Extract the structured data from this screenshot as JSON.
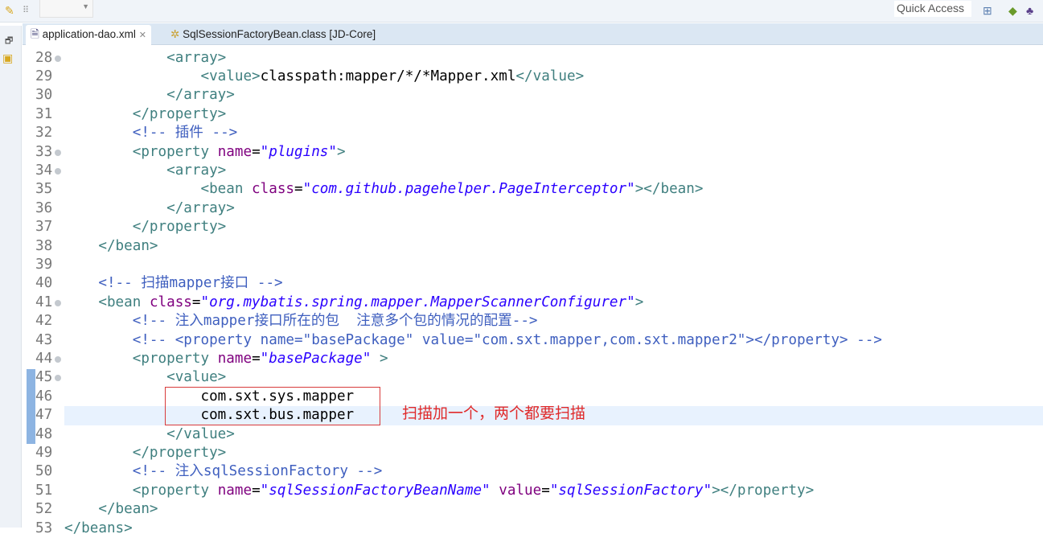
{
  "toolbar": {
    "quick_access_label": "Quick Access"
  },
  "tabs": [
    {
      "label": "application-dao.xml",
      "active": true
    },
    {
      "label": "SqlSessionFactoryBean.class [JD-Core]",
      "active": false
    }
  ],
  "colors": {
    "tag": "#3f7f7f",
    "attr": "#7f007f",
    "value": "#2a00ff",
    "comment": "#3f5fbf",
    "annotation": "#e02a2a"
  },
  "editor": {
    "current_line": 47,
    "changed_lines": [
      45,
      46,
      47,
      48
    ],
    "lines": [
      {
        "n": "28",
        "fold": true,
        "tk": [
          [
            "x",
            "            "
          ],
          [
            "t",
            "<array>"
          ]
        ]
      },
      {
        "n": "29",
        "tk": [
          [
            "x",
            "                "
          ],
          [
            "t",
            "<value>"
          ],
          [
            "x",
            "classpath:mapper/*/*Mapper.xml"
          ],
          [
            "t",
            "</value>"
          ]
        ]
      },
      {
        "n": "30",
        "tk": [
          [
            "x",
            "            "
          ],
          [
            "t",
            "</array>"
          ]
        ]
      },
      {
        "n": "31",
        "tk": [
          [
            "x",
            "        "
          ],
          [
            "t",
            "</property>"
          ]
        ]
      },
      {
        "n": "32",
        "tk": [
          [
            "x",
            "        "
          ],
          [
            "c",
            "<!-- 插件 -->"
          ]
        ]
      },
      {
        "n": "33",
        "fold": true,
        "tk": [
          [
            "x",
            "        "
          ],
          [
            "t",
            "<property "
          ],
          [
            "a",
            "name"
          ],
          [
            "x",
            "="
          ],
          [
            "v",
            "\"plugins\""
          ],
          [
            "t",
            ">"
          ]
        ]
      },
      {
        "n": "34",
        "fold": true,
        "tk": [
          [
            "x",
            "            "
          ],
          [
            "t",
            "<array>"
          ]
        ]
      },
      {
        "n": "35",
        "tk": [
          [
            "x",
            "                "
          ],
          [
            "t",
            "<bean "
          ],
          [
            "a",
            "class"
          ],
          [
            "x",
            "="
          ],
          [
            "v",
            "\"com.github.pagehelper.PageInterceptor\""
          ],
          [
            "t",
            "></bean>"
          ]
        ]
      },
      {
        "n": "36",
        "tk": [
          [
            "x",
            "            "
          ],
          [
            "t",
            "</array>"
          ]
        ]
      },
      {
        "n": "37",
        "tk": [
          [
            "x",
            "        "
          ],
          [
            "t",
            "</property>"
          ]
        ]
      },
      {
        "n": "38",
        "tk": [
          [
            "x",
            "    "
          ],
          [
            "t",
            "</bean>"
          ]
        ]
      },
      {
        "n": "39",
        "tk": []
      },
      {
        "n": "40",
        "tk": [
          [
            "x",
            "    "
          ],
          [
            "c",
            "<!-- 扫描mapper接口 -->"
          ]
        ]
      },
      {
        "n": "41",
        "fold": true,
        "tk": [
          [
            "x",
            "    "
          ],
          [
            "t",
            "<bean "
          ],
          [
            "a",
            "class"
          ],
          [
            "x",
            "="
          ],
          [
            "v",
            "\"org.mybatis.spring.mapper.MapperScannerConfigurer\""
          ],
          [
            "t",
            ">"
          ]
        ]
      },
      {
        "n": "42",
        "tk": [
          [
            "x",
            "        "
          ],
          [
            "c",
            "<!-- 注入mapper接口所在的包  注意多个包的情况的配置-->"
          ]
        ]
      },
      {
        "n": "43",
        "tk": [
          [
            "x",
            "        "
          ],
          [
            "c",
            "<!-- <property name=\"basePackage\" value=\"com.sxt.mapper,com.sxt.mapper2\"></property> -->"
          ]
        ]
      },
      {
        "n": "44",
        "fold": true,
        "tk": [
          [
            "x",
            "        "
          ],
          [
            "t",
            "<property "
          ],
          [
            "a",
            "name"
          ],
          [
            "x",
            "="
          ],
          [
            "v",
            "\"basePackage\""
          ],
          [
            "t",
            " >"
          ]
        ]
      },
      {
        "n": "45",
        "fold": true,
        "tk": [
          [
            "x",
            "            "
          ],
          [
            "t",
            "<value>"
          ]
        ]
      },
      {
        "n": "46",
        "tk": [
          [
            "x",
            "                com.sxt.sys.mapper"
          ]
        ]
      },
      {
        "n": "47",
        "tk": [
          [
            "x",
            "                com.sxt.bus.mapper"
          ]
        ]
      },
      {
        "n": "48",
        "tk": [
          [
            "x",
            "            "
          ],
          [
            "t",
            "</value>"
          ]
        ]
      },
      {
        "n": "49",
        "tk": [
          [
            "x",
            "        "
          ],
          [
            "t",
            "</property>"
          ]
        ]
      },
      {
        "n": "50",
        "tk": [
          [
            "x",
            "        "
          ],
          [
            "c",
            "<!-- 注入sqlSessionFactory -->"
          ]
        ]
      },
      {
        "n": "51",
        "tk": [
          [
            "x",
            "        "
          ],
          [
            "t",
            "<property "
          ],
          [
            "a",
            "name"
          ],
          [
            "x",
            "="
          ],
          [
            "v",
            "\"sqlSessionFactoryBeanName\""
          ],
          [
            "x",
            " "
          ],
          [
            "a",
            "value"
          ],
          [
            "x",
            "="
          ],
          [
            "v",
            "\"sqlSessionFactory\""
          ],
          [
            "t",
            "></property>"
          ]
        ]
      },
      {
        "n": "52",
        "tk": [
          [
            "x",
            "    "
          ],
          [
            "t",
            "</bean>"
          ]
        ]
      },
      {
        "n": "53",
        "tk": [
          [
            "t",
            "</beans>"
          ]
        ]
      }
    ]
  },
  "annotation": {
    "text": "扫描加一个，两个都要扫描"
  }
}
